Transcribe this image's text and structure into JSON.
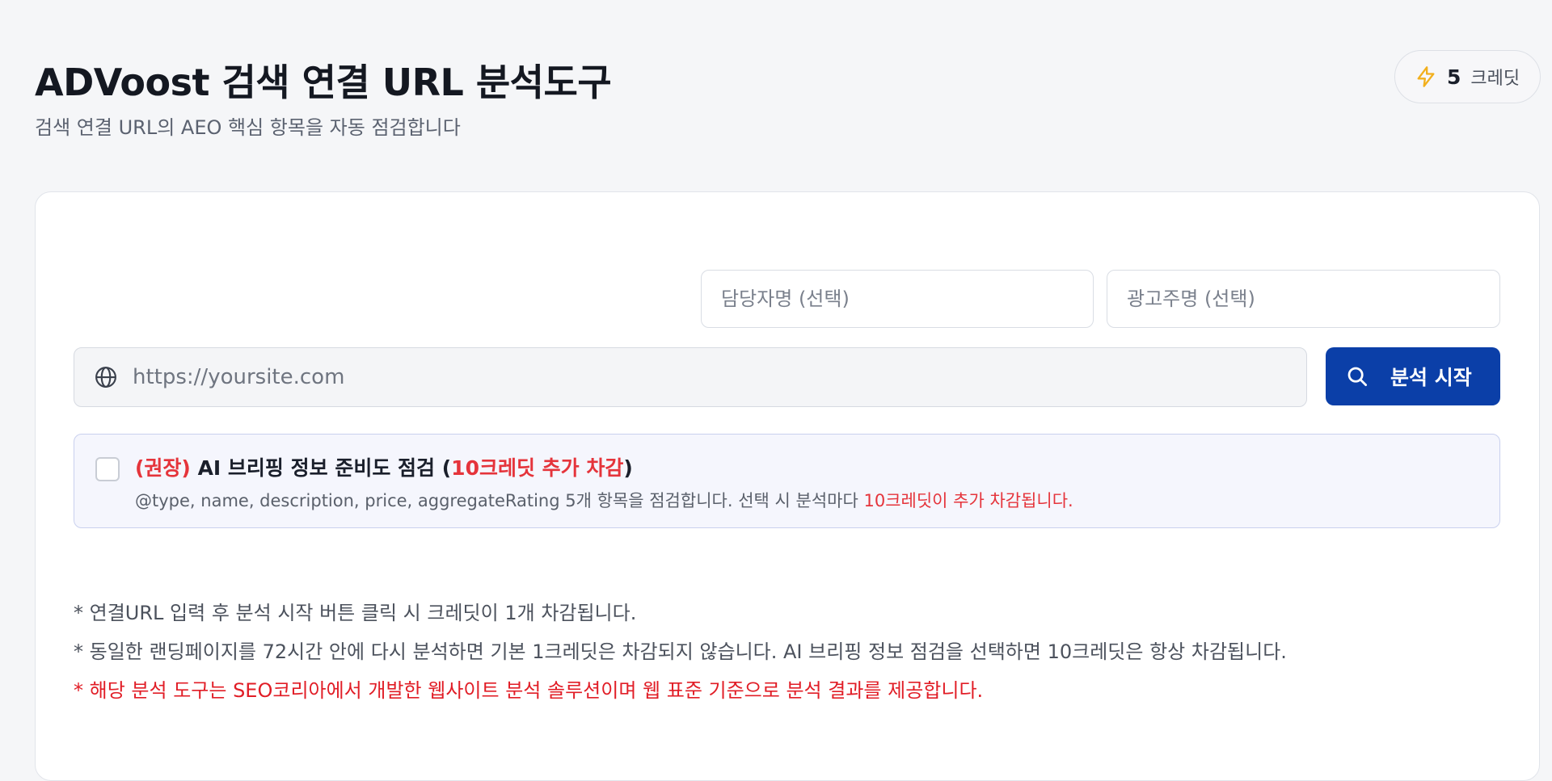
{
  "header": {
    "title": "ADVoost 검색 연결 URL 분석도구",
    "subtitle": "검색 연결 URL의 AEO 핵심 항목을 자동 점검합니다"
  },
  "credits": {
    "icon": "lightning-bolt-icon",
    "count": "5",
    "unit": "크레딧",
    "icon_color": "#f2b01e"
  },
  "form": {
    "manager_placeholder": "담당자명 (선택)",
    "advertiser_placeholder": "광고주명 (선택)",
    "url_placeholder": "https://yoursite.com",
    "url_icon": "globe-icon",
    "analyze_button_label": "분석 시작",
    "analyze_button_icon": "search-icon",
    "analyze_button_color": "#0b3fa8"
  },
  "ai_option": {
    "checked": false,
    "title_prefix": "(권장)",
    "title_main": " AI 브리핑 정보 준비도 점검 (",
    "title_highlight": "10크레딧 추가 차감",
    "title_suffix": ")",
    "description": "@type, name, description, price, aggregateRating 5개 항목을 점검합니다. 선택 시 분석마다 ",
    "description_highlight": "10크레딧이 추가 차감됩니다.",
    "highlight_color": "#e5343b"
  },
  "notes": [
    "* 연결URL 입력 후 분석 시작 버튼 클릭 시 크레딧이 1개 차감됩니다.",
    "* 동일한 랜딩페이지를 72시간 안에 다시 분석하면 기본 1크레딧은 차감되지 않습니다. AI 브리핑 정보 점검을 선택하면 10크레딧은 항상 차감됩니다.",
    "* 해당 분석 도구는 SEO코리아에서 개발한 웹사이트 분석 솔루션이며 웹 표준 기준으로 분석 결과를 제공합니다."
  ]
}
